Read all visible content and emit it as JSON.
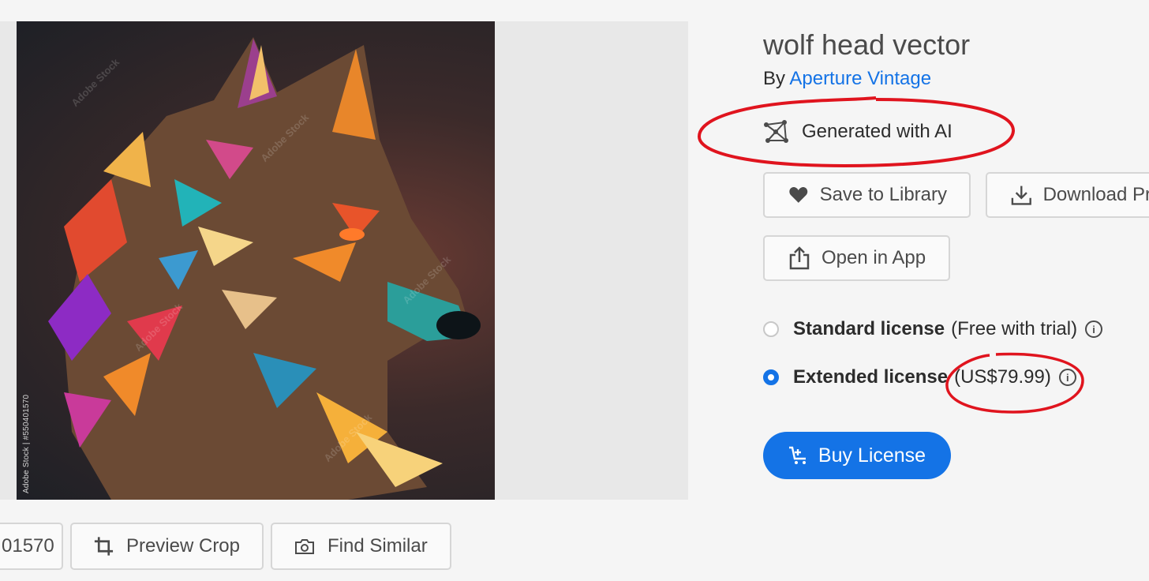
{
  "asset": {
    "title": "wolf head vector",
    "by_prefix": "By",
    "author": "Aperture Vintage",
    "ai_badge": "Generated with AI",
    "watermark": "Adobe Stock | #550401570",
    "watermark_repeat": "Adobe Stock"
  },
  "actions": {
    "save": "Save to Library",
    "download": "Download Pr",
    "open": "Open in App"
  },
  "licenses": [
    {
      "name": "Standard license",
      "detail": "(Free with trial)",
      "selected": false
    },
    {
      "name": "Extended license",
      "detail": "(US$79.99)",
      "selected": true
    }
  ],
  "buy": {
    "label": "Buy License"
  },
  "bottom_bar": {
    "id_partial": "01570",
    "preview_crop": "Preview Crop",
    "find_similar": "Find Similar"
  },
  "colors": {
    "accent": "#1473e6",
    "annotation": "#e0141e"
  }
}
